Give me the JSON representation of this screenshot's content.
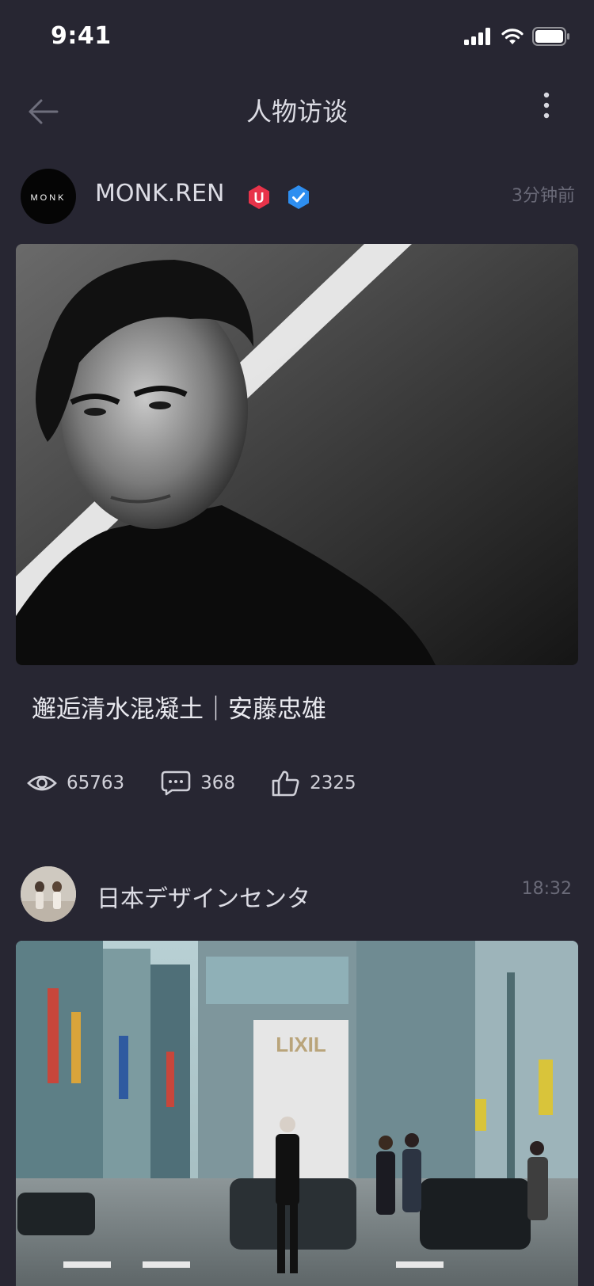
{
  "status": {
    "time": "9:41"
  },
  "nav": {
    "title": "人物访谈"
  },
  "posts": [
    {
      "author": "MONK.REN",
      "avatar_text": "MONK",
      "time": "3分钟前",
      "badge_u": "U",
      "title": "邂逅清水混凝土｜安藤忠雄",
      "stats": {
        "views": "65763",
        "comments": "368",
        "likes": "2325"
      }
    },
    {
      "author": "日本デザインセンタ",
      "time": "18:32"
    }
  ],
  "colors": {
    "background": "#272632",
    "badge_u": "#e8334a",
    "badge_verified": "#2e8ef0"
  }
}
